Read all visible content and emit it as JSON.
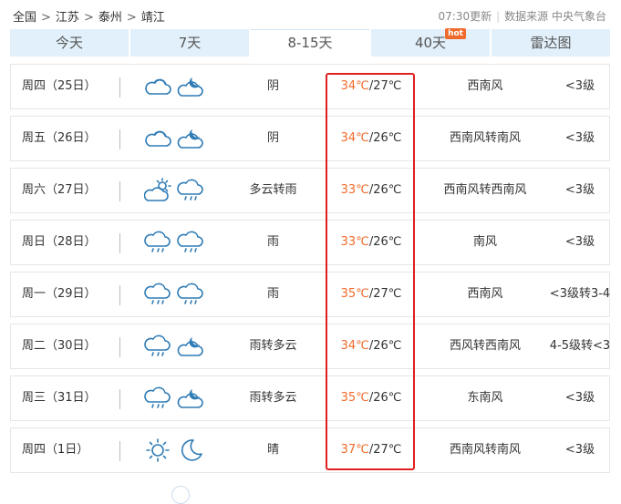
{
  "breadcrumb": [
    "全国",
    "江苏",
    "泰州",
    "靖江"
  ],
  "header": {
    "update_time": "07:30更新",
    "source": "数据来源 中央气象台"
  },
  "tabs": [
    {
      "label": "今天"
    },
    {
      "label": "7天"
    },
    {
      "label": "8-15天",
      "active": true
    },
    {
      "label": "40天",
      "badge": "hot"
    },
    {
      "label": "雷达图"
    }
  ],
  "forecast": [
    {
      "day": "周四（25日）",
      "icons": [
        "cloudy-icon",
        "cloudy-night-icon"
      ],
      "condition": "阴",
      "high": "34℃",
      "low": "/27℃",
      "wind": "西南风",
      "level": "<3级"
    },
    {
      "day": "周五（26日）",
      "icons": [
        "cloudy-icon",
        "cloudy-night-icon"
      ],
      "condition": "阴",
      "high": "34℃",
      "low": "/26℃",
      "wind": "西南风转南风",
      "level": "<3级"
    },
    {
      "day": "周六（27日）",
      "icons": [
        "partly-cloudy-icon",
        "rain-icon"
      ],
      "condition": "多云转雨",
      "high": "33℃",
      "low": "/26℃",
      "wind": "西南风转西南风",
      "level": "<3级"
    },
    {
      "day": "周日（28日）",
      "icons": [
        "rain-icon",
        "rain-icon"
      ],
      "condition": "雨",
      "high": "33℃",
      "low": "/26℃",
      "wind": "南风",
      "level": "<3级"
    },
    {
      "day": "周一（29日）",
      "icons": [
        "rain-icon",
        "rain-icon"
      ],
      "condition": "雨",
      "high": "35℃",
      "low": "/27℃",
      "wind": "西南风",
      "level": "<3级转3-4"
    },
    {
      "day": "周二（30日）",
      "icons": [
        "rain-icon",
        "cloudy-night-icon"
      ],
      "condition": "雨转多云",
      "high": "34℃",
      "low": "/26℃",
      "wind": "西风转西南风",
      "level": "4-5级转<3"
    },
    {
      "day": "周三（31日）",
      "icons": [
        "rain-icon",
        "cloudy-night-icon"
      ],
      "condition": "雨转多云",
      "high": "35℃",
      "low": "/26℃",
      "wind": "东南风",
      "level": "<3级"
    },
    {
      "day": "周四（1日）",
      "icons": [
        "sunny-icon",
        "moon-icon"
      ],
      "condition": "晴",
      "high": "37℃",
      "low": "/27℃",
      "wind": "西南风转南风",
      "level": "<3级"
    }
  ],
  "colors": {
    "accent": "#f06b2b",
    "tab_bg": "#e1f0fa",
    "icon_stroke": "#2f7bb5",
    "highlight": "#e02020"
  }
}
